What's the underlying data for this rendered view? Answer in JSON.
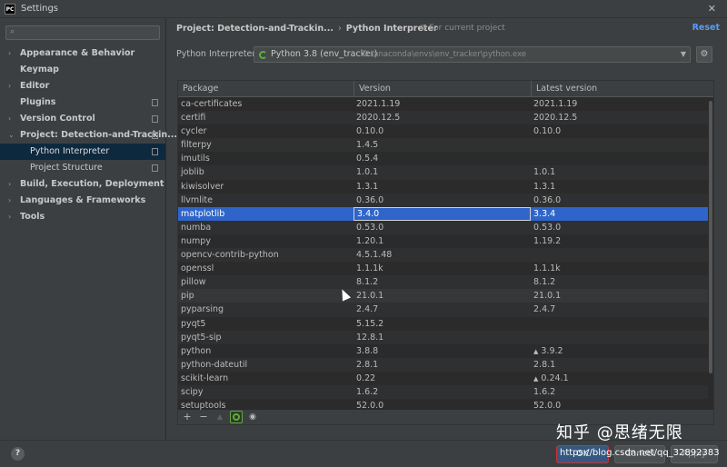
{
  "window": {
    "title": "Settings",
    "logo_text": "PC",
    "close_icon": "✕"
  },
  "sidebar": {
    "search_placeholder": "",
    "items": [
      {
        "label": "Appearance & Behavior",
        "expanded": false,
        "level": 0
      },
      {
        "label": "Keymap",
        "level": 0
      },
      {
        "label": "Editor",
        "expanded": false,
        "level": 0
      },
      {
        "label": "Plugins",
        "level": 0
      },
      {
        "label": "Version Control",
        "expanded": false,
        "level": 0
      },
      {
        "label": "Project: Detection-and-Trackin...",
        "expanded": true,
        "level": 0
      },
      {
        "label": "Python Interpreter",
        "level": 1,
        "selected": true
      },
      {
        "label": "Project Structure",
        "level": 1
      },
      {
        "label": "Build, Execution, Deployment",
        "expanded": false,
        "level": 0
      },
      {
        "label": "Languages & Frameworks",
        "expanded": false,
        "level": 0
      },
      {
        "label": "Tools",
        "expanded": false,
        "level": 0
      }
    ]
  },
  "header": {
    "breadcrumb_project": "Project: Detection-and-Trackin...",
    "breadcrumb_page": "Python Interpreter",
    "for_current_project": "For current project",
    "reset": "Reset"
  },
  "interpreter": {
    "label": "Python Interpreter:",
    "name": "Python 3.8 (env_tracker)",
    "path": "D:\\anaconda\\envs\\env_tracker\\python.exe"
  },
  "table": {
    "columns": [
      "Package",
      "Version",
      "Latest version"
    ],
    "rows": [
      {
        "package": "ca-certificates",
        "version": "2021.1.19",
        "latest": "2021.1.19",
        "upgrade": false
      },
      {
        "package": "certifi",
        "version": "2020.12.5",
        "latest": "2020.12.5",
        "upgrade": false
      },
      {
        "package": "cycler",
        "version": "0.10.0",
        "latest": "0.10.0",
        "upgrade": false
      },
      {
        "package": "filterpy",
        "version": "1.4.5",
        "latest": "",
        "upgrade": false
      },
      {
        "package": "imutils",
        "version": "0.5.4",
        "latest": "",
        "upgrade": false
      },
      {
        "package": "joblib",
        "version": "1.0.1",
        "latest": "1.0.1",
        "upgrade": false
      },
      {
        "package": "kiwisolver",
        "version": "1.3.1",
        "latest": "1.3.1",
        "upgrade": false
      },
      {
        "package": "llvmlite",
        "version": "0.36.0",
        "latest": "0.36.0",
        "upgrade": false
      },
      {
        "package": "matplotlib",
        "version": "3.4.0",
        "latest": "3.3.4",
        "upgrade": false
      },
      {
        "package": "numba",
        "version": "0.53.0",
        "latest": "0.53.0",
        "upgrade": false
      },
      {
        "package": "numpy",
        "version": "1.20.1",
        "latest": "1.19.2",
        "upgrade": false
      },
      {
        "package": "opencv-contrib-python",
        "version": "4.5.1.48",
        "latest": "",
        "upgrade": false
      },
      {
        "package": "openssl",
        "version": "1.1.1k",
        "latest": "1.1.1k",
        "upgrade": false
      },
      {
        "package": "pillow",
        "version": "8.1.2",
        "latest": "8.1.2",
        "upgrade": false
      },
      {
        "package": "pip",
        "version": "21.0.1",
        "latest": "21.0.1",
        "upgrade": false
      },
      {
        "package": "pyparsing",
        "version": "2.4.7",
        "latest": "2.4.7",
        "upgrade": false
      },
      {
        "package": "pyqt5",
        "version": "5.15.2",
        "latest": "",
        "upgrade": false
      },
      {
        "package": "pyqt5-sip",
        "version": "12.8.1",
        "latest": "",
        "upgrade": false
      },
      {
        "package": "python",
        "version": "3.8.8",
        "latest": "3.9.2",
        "upgrade": true
      },
      {
        "package": "python-dateutil",
        "version": "2.8.1",
        "latest": "2.8.1",
        "upgrade": false
      },
      {
        "package": "scikit-learn",
        "version": "0.22",
        "latest": "0.24.1",
        "upgrade": true
      },
      {
        "package": "scipy",
        "version": "1.6.2",
        "latest": "1.6.2",
        "upgrade": false
      },
      {
        "package": "setuptools",
        "version": "52.0.0",
        "latest": "52.0.0",
        "upgrade": false
      }
    ],
    "selected_row": 8,
    "hover_row": 14
  },
  "toolbar": {
    "add_icon": "+",
    "remove_icon": "−",
    "upgrade_icon": "▲",
    "show_early_icon": "◉"
  },
  "footer": {
    "help": "?",
    "ok": "OK",
    "cancel": "Cancel",
    "apply": "Apply"
  },
  "watermark": {
    "line1": "知乎 @思绪无限",
    "line2": "https://blog.csdn.net/qq_32892383"
  },
  "colors": {
    "selection": "#2f65ca",
    "sidebar_selection": "#0d293e",
    "link": "#589df6",
    "accent_green": "#5faa3e"
  }
}
